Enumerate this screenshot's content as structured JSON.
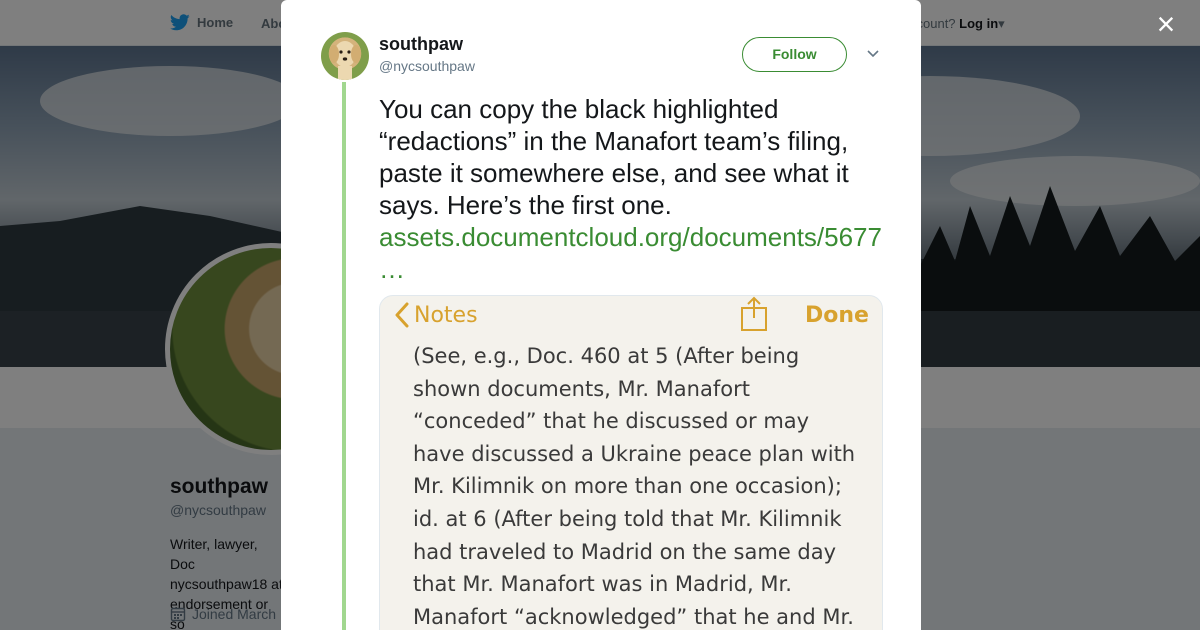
{
  "nav": {
    "home": "Home",
    "about": "Abo",
    "login_prefix": "ccount?",
    "login": "Log in"
  },
  "profile": {
    "name": "southpaw",
    "handle": "@nycsouthpaw",
    "bio_lines": [
      "Writer, lawyer, Doc",
      "nycsouthpaw18 at",
      "endorsement or so"
    ],
    "joined": "Joined March"
  },
  "modal": {
    "name": "southpaw",
    "handle": "@nycsouthpaw",
    "follow_label": "Follow",
    "tweet_text": "You can copy the black highlighted “redactions” in the Manafort team’s filing, paste it somewhere else, and see what it says. Here’s the first one.",
    "tweet_link": "assets.documentcloud.org/documents/5677 …",
    "close_label": "×"
  },
  "notes": {
    "back_label": "Notes",
    "done_label": "Done",
    "lines": [
      "(See, e.g., Doc. 460 at 5 (After being",
      "shown documents, Mr. Manafort",
      "“conceded” that he discussed or may",
      "have discussed a Ukraine peace plan with",
      "Mr. Kilimnik on more than one occasion);",
      "id. at 6 (After being told that Mr. Kilimnik",
      "had traveled to Madrid on the same day",
      "that Mr. Manafort was in Madrid, Mr.",
      "Manafort “acknowledged” that he and Mr."
    ]
  },
  "colors": {
    "accent": "#3a8c33",
    "thread": "#a1d78f",
    "notes_yellow": "#d8a22e"
  }
}
